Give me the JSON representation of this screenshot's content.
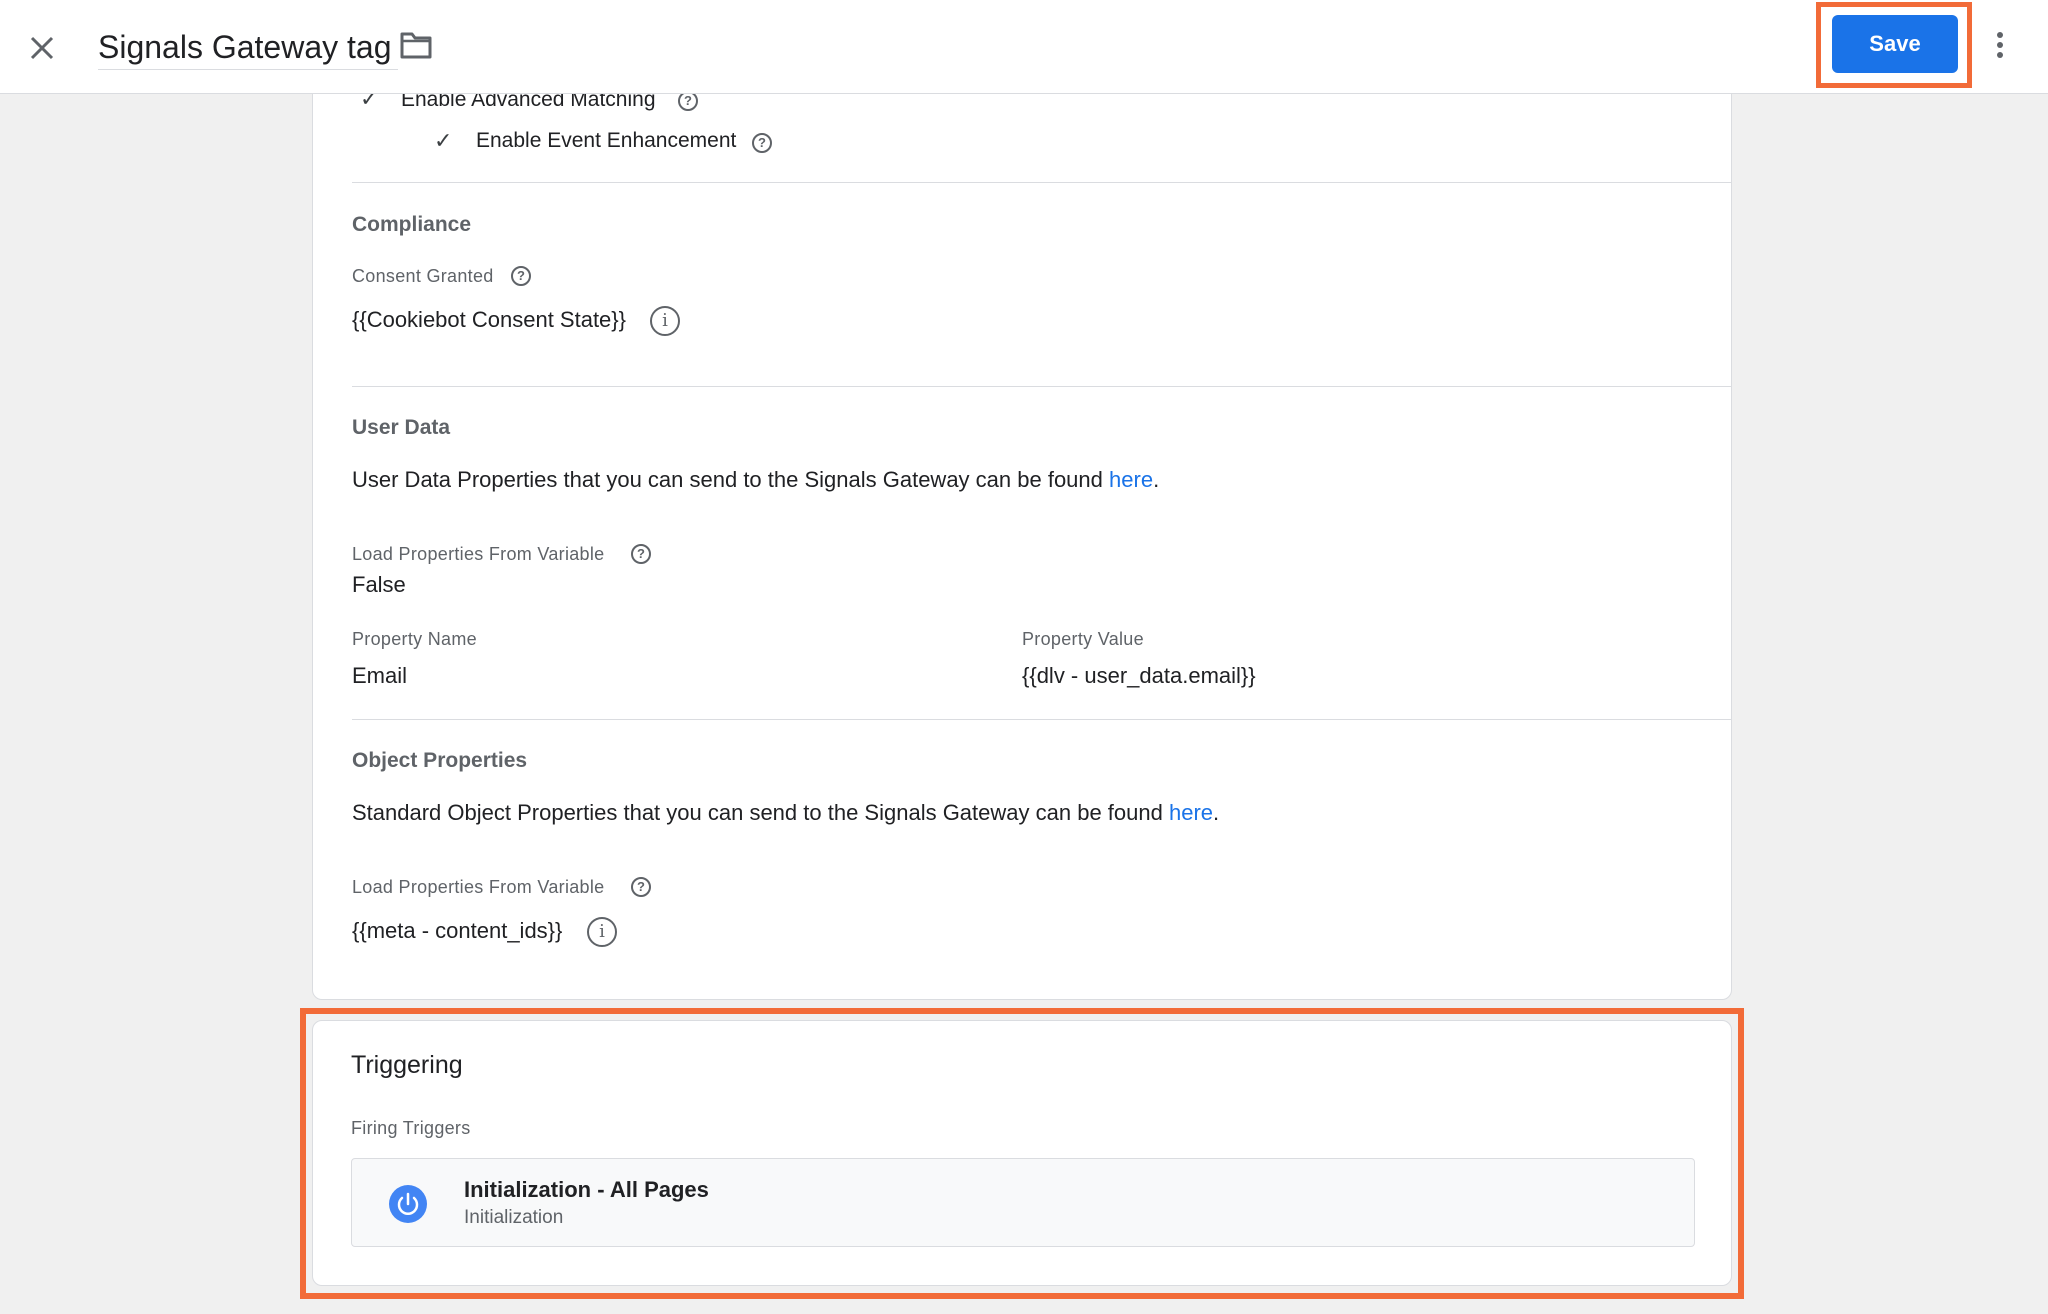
{
  "header": {
    "title": "Signals Gateway tag",
    "save_label": "Save"
  },
  "options": {
    "advanced_matching": "Enable Advanced Matching",
    "event_enhancement": "Enable Event Enhancement"
  },
  "compliance": {
    "title": "Compliance",
    "consent_label": "Consent Granted",
    "consent_value": "{{Cookiebot Consent State}}"
  },
  "user_data": {
    "title": "User Data",
    "description": "User Data Properties that you can send to the Signals Gateway can be found ",
    "link": "here",
    "period": ".",
    "load_label": "Load Properties From Variable",
    "load_value": "False",
    "property_name_label": "Property Name",
    "property_name_value": "Email",
    "property_value_label": "Property Value",
    "property_value_value": "{{dlv - user_data.email}}"
  },
  "object_properties": {
    "title": "Object Properties",
    "description": "Standard Object Properties that you can send to the Signals Gateway can be found ",
    "link": "here",
    "period": ".",
    "load_label": "Load Properties From Variable",
    "load_value": "{{meta - content_ids}}"
  },
  "triggering": {
    "title": "Triggering",
    "firing_label": "Firing Triggers",
    "trigger_name": "Initialization - All Pages",
    "trigger_type": "Initialization"
  },
  "colors": {
    "accent": "#1a73e8",
    "highlight": "#f26b38",
    "trigger_icon": "#4285f4"
  },
  "icons": {
    "close": "close-icon",
    "folder": "folder-icon",
    "more": "more-vert-icon",
    "check": "check-icon",
    "help": "help-icon",
    "info": "info-icon",
    "power": "power-icon"
  }
}
